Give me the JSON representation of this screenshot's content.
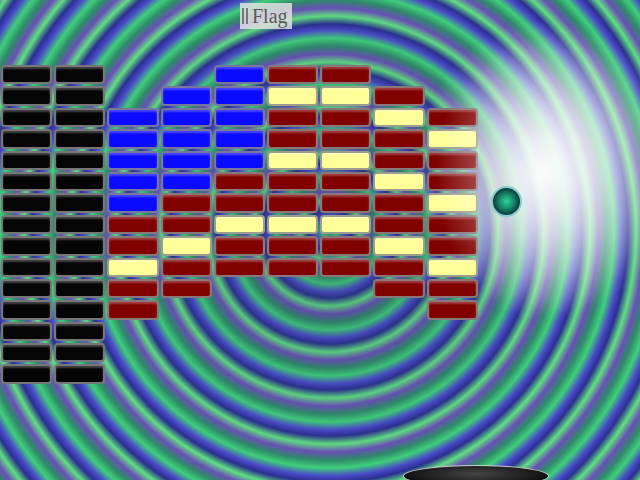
{
  "title": "Flag",
  "bricks": [
    [
      {
        "color": "#050505"
      },
      {
        "color": "#050505"
      },
      null,
      null,
      {
        "color": "#0a0aff"
      },
      {
        "color": "#800000"
      },
      {
        "color": "#800000"
      },
      null,
      null
    ],
    [
      {
        "color": "#050505"
      },
      {
        "color": "#050505"
      },
      null,
      {
        "color": "#0a0aff"
      },
      {
        "color": "#0a0aff"
      },
      {
        "color": "#ffff99"
      },
      {
        "color": "#ffff99"
      },
      {
        "color": "#800000"
      },
      null
    ],
    [
      {
        "color": "#050505"
      },
      {
        "color": "#050505"
      },
      {
        "color": "#0a0aff"
      },
      {
        "color": "#0a0aff"
      },
      {
        "color": "#0a0aff"
      },
      {
        "color": "#800000"
      },
      {
        "color": "#800000"
      },
      {
        "color": "#ffff99"
      },
      {
        "color": "#800000"
      }
    ],
    [
      {
        "color": "#050505"
      },
      {
        "color": "#050505"
      },
      {
        "color": "#0a0aff"
      },
      {
        "color": "#0a0aff"
      },
      {
        "color": "#0a0aff"
      },
      {
        "color": "#800000"
      },
      {
        "color": "#800000"
      },
      {
        "color": "#800000"
      },
      {
        "color": "#ffff99"
      }
    ],
    [
      {
        "color": "#050505"
      },
      {
        "color": "#050505"
      },
      {
        "color": "#0a0aff"
      },
      {
        "color": "#0a0aff"
      },
      {
        "color": "#0a0aff"
      },
      {
        "color": "#ffff99"
      },
      {
        "color": "#ffff99"
      },
      {
        "color": "#800000"
      },
      {
        "color": "#800000"
      }
    ],
    [
      {
        "color": "#050505"
      },
      {
        "color": "#050505"
      },
      {
        "color": "#0a0aff"
      },
      {
        "color": "#0a0aff"
      },
      {
        "color": "#800000"
      },
      {
        "color": "#800000"
      },
      {
        "color": "#800000"
      },
      {
        "color": "#ffff99"
      },
      {
        "color": "#800000"
      }
    ],
    [
      {
        "color": "#050505"
      },
      {
        "color": "#050505"
      },
      {
        "color": "#0a0aff"
      },
      {
        "color": "#800000"
      },
      {
        "color": "#800000"
      },
      {
        "color": "#800000"
      },
      {
        "color": "#800000"
      },
      {
        "color": "#800000"
      },
      {
        "color": "#ffff99"
      }
    ],
    [
      {
        "color": "#050505"
      },
      {
        "color": "#050505"
      },
      {
        "color": "#800000"
      },
      {
        "color": "#800000"
      },
      {
        "color": "#ffff99"
      },
      {
        "color": "#ffff99"
      },
      {
        "color": "#ffff99"
      },
      {
        "color": "#800000"
      },
      {
        "color": "#800000"
      }
    ],
    [
      {
        "color": "#050505"
      },
      {
        "color": "#050505"
      },
      {
        "color": "#800000"
      },
      {
        "color": "#ffff99"
      },
      {
        "color": "#800000"
      },
      {
        "color": "#800000"
      },
      {
        "color": "#800000"
      },
      {
        "color": "#ffff99"
      },
      {
        "color": "#800000"
      }
    ],
    [
      {
        "color": "#050505"
      },
      {
        "color": "#050505"
      },
      {
        "color": "#ffff99"
      },
      {
        "color": "#800000"
      },
      {
        "color": "#800000"
      },
      {
        "color": "#800000"
      },
      {
        "color": "#800000"
      },
      {
        "color": "#800000"
      },
      {
        "color": "#ffff99"
      }
    ],
    [
      {
        "color": "#050505"
      },
      {
        "color": "#050505"
      },
      {
        "color": "#800000"
      },
      {
        "color": "#800000"
      },
      null,
      null,
      null,
      {
        "color": "#800000"
      },
      {
        "color": "#800000"
      }
    ],
    [
      {
        "color": "#050505"
      },
      {
        "color": "#050505"
      },
      {
        "color": "#800000"
      },
      null,
      null,
      null,
      null,
      null,
      {
        "color": "#800000"
      }
    ],
    [
      {
        "color": "#050505"
      },
      {
        "color": "#050505"
      },
      null,
      null,
      null,
      null,
      null,
      null,
      null
    ],
    [
      {
        "color": "#050505"
      },
      {
        "color": "#050505"
      },
      null,
      null,
      null,
      null,
      null,
      null,
      null
    ],
    [
      {
        "color": "#050505"
      },
      {
        "color": "#050505"
      },
      null,
      null,
      null,
      null,
      null,
      null,
      null
    ]
  ]
}
